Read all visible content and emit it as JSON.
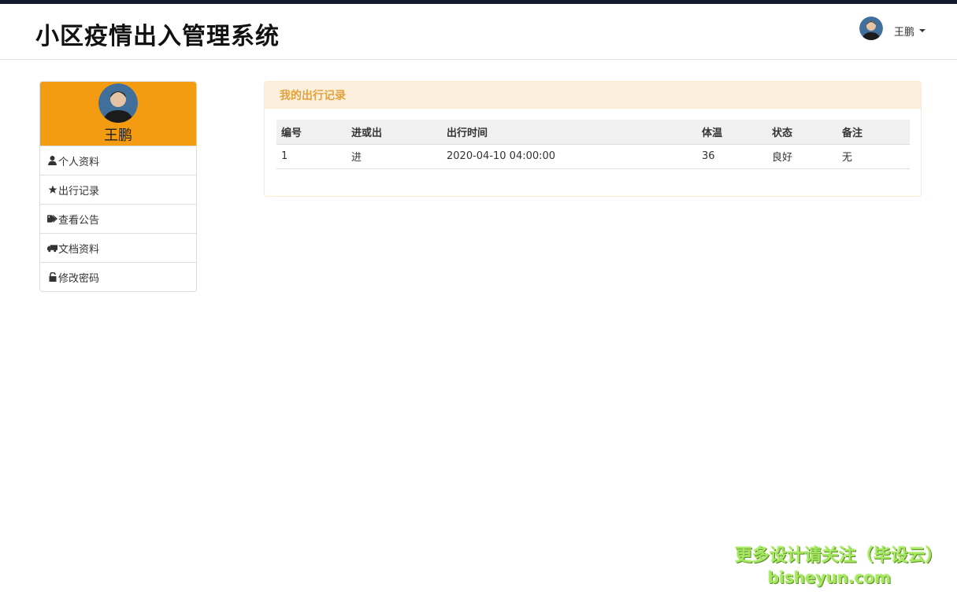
{
  "app": {
    "title": "小区疫情出入管理系统"
  },
  "user_menu": {
    "name": "王鹏",
    "avatar_icon": "user-avatar-icon",
    "caret_icon": "caret-down-icon"
  },
  "sidebar": {
    "profile_name": "王鹏",
    "accent_color": "#f39c12",
    "items": [
      {
        "label": "个人资料",
        "icon": "user-icon"
      },
      {
        "label": "出行记录",
        "icon": "star-icon"
      },
      {
        "label": "查看公告",
        "icon": "tags-icon"
      },
      {
        "label": "文档资料",
        "icon": "truck-icon"
      },
      {
        "label": "修改密码",
        "icon": "unlock-icon"
      }
    ]
  },
  "panel": {
    "title": "我的出行记录",
    "columns": [
      "编号",
      "进或出",
      "出行时间",
      "体温",
      "状态",
      "备注"
    ],
    "rows": [
      [
        "1",
        "进",
        "2020-04-10 04:00:00",
        "36",
        "良好",
        "无"
      ]
    ]
  },
  "watermark": {
    "line1": "更多设计请关注（毕设云）",
    "line2": "bisheyun.com"
  }
}
